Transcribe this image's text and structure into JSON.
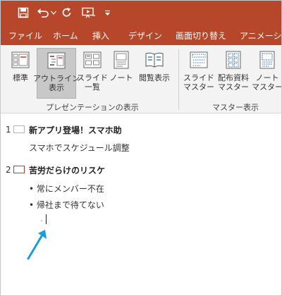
{
  "qat": {
    "icons": [
      "save-icon",
      "undo-icon",
      "dropdown-icon",
      "redo-icon",
      "start-slideshow-icon",
      "customize-qat-icon"
    ]
  },
  "tabs": [
    "ファイル",
    "ホーム",
    "挿入",
    "デザイン",
    "画面切り替え",
    "アニメーション"
  ],
  "ribbon": {
    "presentation_views": {
      "label": "プレゼンテーションの表示",
      "buttons": [
        {
          "line1": "標準",
          "line2": "",
          "active": false,
          "icon": "normal-view-icon"
        },
        {
          "line1": "アウトライン",
          "line2": "表示",
          "active": true,
          "icon": "outline-view-icon"
        },
        {
          "line1": "スライド",
          "line2": "一覧",
          "active": false,
          "icon": "slide-sorter-icon"
        },
        {
          "line1": "ノート",
          "line2": "",
          "active": false,
          "icon": "notes-page-icon"
        },
        {
          "line1": "閲覧表示",
          "line2": "",
          "active": false,
          "icon": "reading-view-icon"
        }
      ]
    },
    "master_views": {
      "label": "マスター表示",
      "buttons": [
        {
          "line1": "スライド",
          "line2": "マスター",
          "icon": "slide-master-icon"
        },
        {
          "line1": "配布資料",
          "line2": "マスター",
          "icon": "handout-master-icon"
        },
        {
          "line1": "ノート",
          "line2": "マスター",
          "icon": "notes-master-icon"
        }
      ]
    }
  },
  "outline": {
    "slides": [
      {
        "number": "1",
        "title": "新アプリ登場！スマホ助",
        "lines": [
          "スマホでスケジュール調整"
        ]
      },
      {
        "number": "2",
        "title": "苦労だらけのリスケ",
        "lines": [
          "• 常にメンバー不在",
          "• 帰社まで待てない"
        ]
      }
    ]
  },
  "colors": {
    "titlebar": "#b7472a",
    "ribbon_bg": "#f3f3f3",
    "accent": "#c43e1c",
    "arrow": "#1a9be0"
  }
}
